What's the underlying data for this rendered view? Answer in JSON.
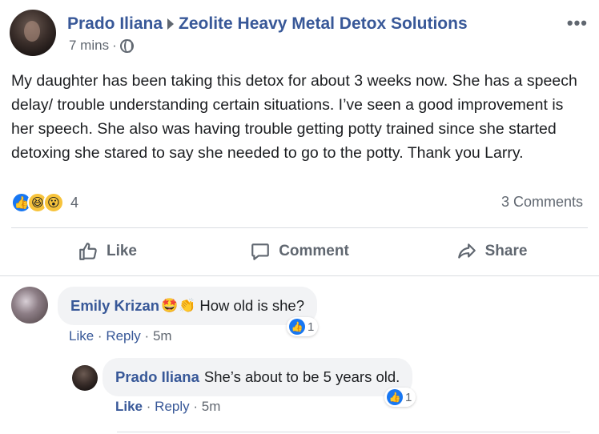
{
  "post": {
    "author": "Prado Iliana",
    "group": "Zeolite Heavy Metal Detox Solutions",
    "time": "7 mins",
    "separator": "·",
    "more_icon": "more-dots-icon",
    "body": "My daughter has been taking this detox for about 3 weeks now. She has a speech delay/ trouble understanding certain situations. I’ve seen a good improvement is her speech. She also was having trouble getting potty trained since she started detoxing she stared to say she needed to go to the potty. Thank you Larry.",
    "reactions_count": "4",
    "comments_count": "3 Comments"
  },
  "actions": {
    "like": "Like",
    "comment": "Comment",
    "share": "Share"
  },
  "comments": [
    {
      "name": "Emily Krizan",
      "emojis": [
        "🤩",
        "👏"
      ],
      "text": "How old is she?",
      "like_count": "1",
      "like_label": "Like",
      "reply_label": "Reply",
      "time": "5m",
      "dot": "·"
    },
    {
      "name": "Prado Iliana",
      "text": "She’s about to be 5 years old.",
      "like_count": "1",
      "like_label": "Like",
      "reply_label": "Reply",
      "time": "5m",
      "dot": "·"
    }
  ],
  "colors": {
    "name_link": "#385898",
    "secondary_text": "#606770",
    "like_blue": "#1877f2",
    "bubble_bg": "#f2f3f5",
    "divider": "#dadde1"
  }
}
